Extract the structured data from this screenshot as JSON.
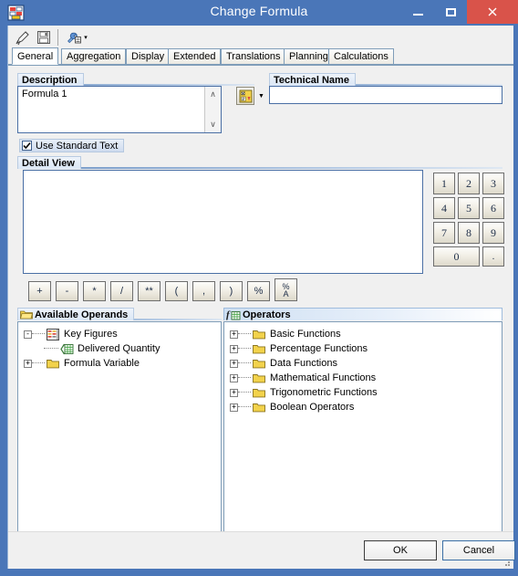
{
  "window": {
    "title": "Change Formula",
    "icon": "formula-window-icon",
    "controls": {
      "minimize": "minimize-button",
      "maximize": "maximize-button",
      "close": "close-button"
    }
  },
  "toolbar": {
    "items": [
      {
        "name": "edit-icon",
        "tooltip": "Edit"
      },
      {
        "name": "save-icon",
        "tooltip": "Save"
      },
      {
        "name": "tools-icon",
        "tooltip": "Tools"
      }
    ],
    "dropdown_arrow": "▾"
  },
  "tabs": [
    {
      "label": "General",
      "active": true
    },
    {
      "label": "Aggregation",
      "active": false
    },
    {
      "label": "Display",
      "active": false
    },
    {
      "label": "Extended",
      "active": false
    },
    {
      "label": "Translations",
      "active": false
    },
    {
      "label": "Planning",
      "active": false
    },
    {
      "label": "Calculations",
      "active": false
    }
  ],
  "description": {
    "group_label": "Description",
    "value": "Formula 1",
    "placeholder": "",
    "scroll_up": "∧",
    "scroll_down": "∨",
    "icon_button": "text-variable-icon",
    "dropdown_arrow": "▼"
  },
  "technical_name": {
    "group_label": "Technical Name",
    "value": "",
    "placeholder": ""
  },
  "standard_text": {
    "label": "Use Standard Text",
    "checked": true
  },
  "detail_view": {
    "group_label": "Detail View",
    "formula": "",
    "watermark": ""
  },
  "keypad": {
    "keys": [
      "1",
      "2",
      "3",
      "4",
      "5",
      "6",
      "7",
      "8",
      "9"
    ],
    "zero": "0",
    "decimal": "."
  },
  "operator_buttons": [
    {
      "label": "+",
      "name": "operator-plus"
    },
    {
      "label": "-",
      "name": "operator-minus"
    },
    {
      "label": "*",
      "name": "operator-multiply"
    },
    {
      "label": "/",
      "name": "operator-divide"
    },
    {
      "label": "**",
      "name": "operator-power"
    },
    {
      "label": "(",
      "name": "operator-open-paren"
    },
    {
      "label": ",",
      "name": "operator-comma"
    },
    {
      "label": ")",
      "name": "operator-close-paren"
    },
    {
      "label": "%",
      "name": "operator-percent"
    },
    {
      "label": "%A",
      "name": "operator-percent-a",
      "stacked": true,
      "top": "%",
      "bottom": "A"
    }
  ],
  "available_operands": {
    "group_label": "Available Operands",
    "group_icon": "open-folder-icon",
    "tree": [
      {
        "label": "Key Figures",
        "icon": "key-figures-icon",
        "expander": "-",
        "level": 0
      },
      {
        "label": "Delivered Quantity",
        "icon": "key-figure-item-icon",
        "expander": "",
        "level": 1
      },
      {
        "label": "Formula Variable",
        "icon": "folder-icon",
        "expander": "+",
        "level": 0
      }
    ]
  },
  "operators": {
    "group_label": "Operators",
    "group_icon": "function-icon",
    "tree": [
      {
        "label": "Basic Functions",
        "icon": "folder-icon",
        "expander": "+"
      },
      {
        "label": "Percentage Functions",
        "icon": "folder-icon",
        "expander": "+"
      },
      {
        "label": "Data Functions",
        "icon": "folder-icon",
        "expander": "+"
      },
      {
        "label": "Mathematical Functions",
        "icon": "folder-icon",
        "expander": "+"
      },
      {
        "label": "Trigonometric Functions",
        "icon": "folder-icon",
        "expander": "+"
      },
      {
        "label": "Boolean Operators",
        "icon": "folder-icon",
        "expander": "+"
      }
    ]
  },
  "footer": {
    "ok_label": "OK",
    "cancel_label": "Cancel"
  },
  "colors": {
    "titlebar": "#4a76b8",
    "close_button": "#d9534a",
    "field_border": "#4a6fa5",
    "panel_bg": "#f0f0f0",
    "group_rule": "#6d93c4"
  }
}
